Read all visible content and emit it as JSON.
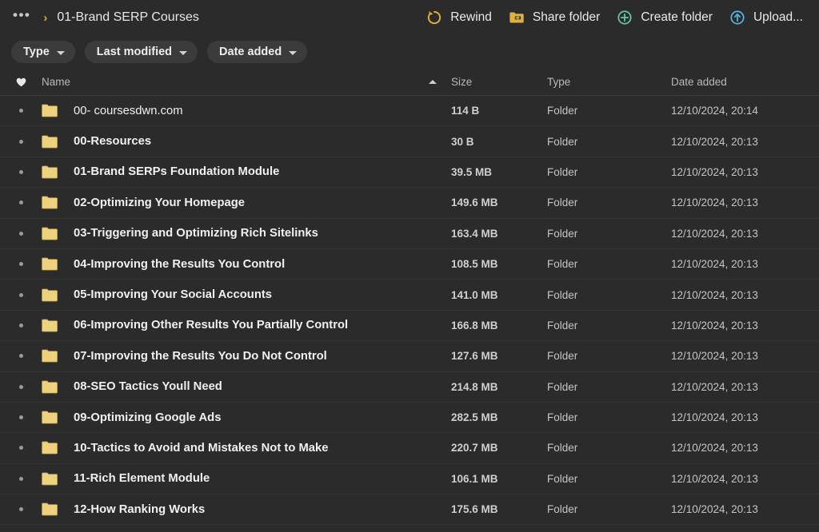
{
  "breadcrumb": {
    "overflow_label": "•••",
    "separator": "›",
    "current": "01-Brand SERP Courses"
  },
  "toolbar": {
    "buttons": [
      {
        "label": "Rewind",
        "icon": "rewind-icon",
        "color": "#e0b23c"
      },
      {
        "label": "Share folder",
        "icon": "share-folder-icon",
        "color": "#e0b23c"
      },
      {
        "label": "Create folder",
        "icon": "create-folder-icon",
        "color": "#6ec4a8"
      },
      {
        "label": "Upload...",
        "icon": "upload-icon",
        "color": "#57b6e0"
      }
    ]
  },
  "filters": [
    {
      "label": "Type",
      "icon": "chevron-down-icon"
    },
    {
      "label": "Last modified",
      "icon": "chevron-down-icon"
    },
    {
      "label": "Date added",
      "icon": "chevron-down-icon"
    }
  ],
  "table": {
    "columns": {
      "favorite": "",
      "name": "Name",
      "size": "Size",
      "type": "Type",
      "date_added": "Date added"
    },
    "sort": {
      "column": "Name",
      "direction": "ascending"
    },
    "rows": [
      {
        "name": "00- coursesdwn.com",
        "size": "114 B",
        "type": "Folder",
        "date_added": "12/10/2024, 20:14",
        "name_weight": "light"
      },
      {
        "name": "00-Resources",
        "size": "30 B",
        "type": "Folder",
        "date_added": "12/10/2024, 20:13",
        "name_weight": "bold"
      },
      {
        "name": "01-Brand SERPs Foundation Module",
        "size": "39.5 MB",
        "type": "Folder",
        "date_added": "12/10/2024, 20:13",
        "name_weight": "bold"
      },
      {
        "name": "02-Optimizing Your Homepage",
        "size": "149.6 MB",
        "type": "Folder",
        "date_added": "12/10/2024, 20:13",
        "name_weight": "bold"
      },
      {
        "name": "03-Triggering and Optimizing Rich Sitelinks",
        "size": "163.4 MB",
        "type": "Folder",
        "date_added": "12/10/2024, 20:13",
        "name_weight": "bold"
      },
      {
        "name": "04-Improving the Results You Control",
        "size": "108.5 MB",
        "type": "Folder",
        "date_added": "12/10/2024, 20:13",
        "name_weight": "bold"
      },
      {
        "name": "05-Improving Your Social Accounts",
        "size": "141.0 MB",
        "type": "Folder",
        "date_added": "12/10/2024, 20:13",
        "name_weight": "bold"
      },
      {
        "name": "06-Improving Other Results You Partially Control",
        "size": "166.8 MB",
        "type": "Folder",
        "date_added": "12/10/2024, 20:13",
        "name_weight": "bold"
      },
      {
        "name": "07-Improving the Results You Do Not Control",
        "size": "127.6 MB",
        "type": "Folder",
        "date_added": "12/10/2024, 20:13",
        "name_weight": "bold"
      },
      {
        "name": "08-SEO Tactics Youll Need",
        "size": "214.8 MB",
        "type": "Folder",
        "date_added": "12/10/2024, 20:13",
        "name_weight": "bold"
      },
      {
        "name": "09-Optimizing Google Ads",
        "size": "282.5 MB",
        "type": "Folder",
        "date_added": "12/10/2024, 20:13",
        "name_weight": "bold"
      },
      {
        "name": "10-Tactics to Avoid and Mistakes Not to Make",
        "size": "220.7 MB",
        "type": "Folder",
        "date_added": "12/10/2024, 20:13",
        "name_weight": "bold"
      },
      {
        "name": "11-Rich Element Module",
        "size": "106.1 MB",
        "type": "Folder",
        "date_added": "12/10/2024, 20:13",
        "name_weight": "bold"
      },
      {
        "name": "12-How Ranking Works",
        "size": "175.6 MB",
        "type": "Folder",
        "date_added": "12/10/2024, 20:13",
        "name_weight": "bold"
      }
    ]
  },
  "colors": {
    "background": "#2b2b2b",
    "folder": "#edd27e",
    "accent_gold": "#d9a93a",
    "accent_teal": "#6ec4a8",
    "accent_blue": "#57b6e0"
  }
}
